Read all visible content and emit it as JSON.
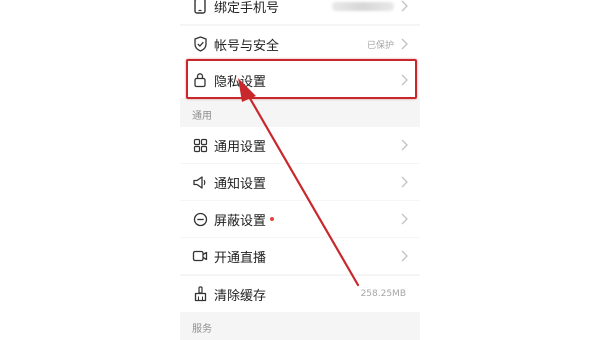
{
  "colors": {
    "highlight": "#c8282c",
    "arrow": "#c8282c",
    "red_dot": "#e0463c",
    "icon": "#333333",
    "chevron": "#c2c2c2"
  },
  "settings": {
    "bind_phone": {
      "label": "绑定手机号",
      "icon": "phone-icon",
      "value_obscured": true
    },
    "account_security": {
      "label": "帐号与安全",
      "icon": "shield-check-icon",
      "value": "已保护"
    },
    "privacy": {
      "label": "隐私设置",
      "icon": "lock-icon"
    }
  },
  "general_section": {
    "header": "通用",
    "items": [
      {
        "label": "通用设置",
        "icon": "grid-icon",
        "value": ""
      },
      {
        "label": "通知设置",
        "icon": "speaker-icon",
        "value": ""
      },
      {
        "label": "屏蔽设置",
        "icon": "block-icon",
        "value": "",
        "has_red_dot": true
      },
      {
        "label": "开通直播",
        "icon": "video-camera-icon",
        "value": ""
      },
      {
        "label": "清除缓存",
        "icon": "broom-icon",
        "value": "258.25MB"
      }
    ]
  },
  "services_section": {
    "header": "服务"
  }
}
